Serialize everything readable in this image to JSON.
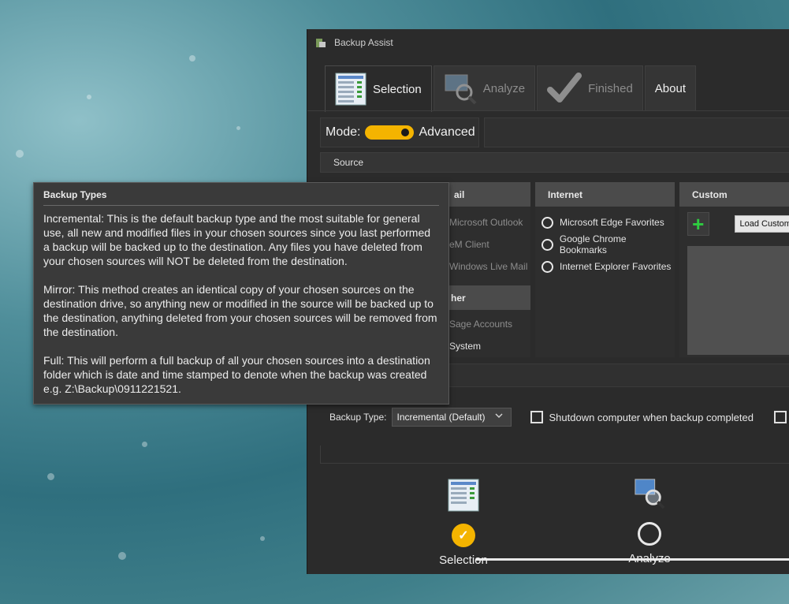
{
  "window": {
    "title": "Backup Assist"
  },
  "tabs": [
    {
      "label": "Selection",
      "active": true
    },
    {
      "label": "Analyze",
      "active": false
    },
    {
      "label": "Finished",
      "active": false
    },
    {
      "label": "About",
      "active": false
    }
  ],
  "mode": {
    "label": "Mode:",
    "value": "Advanced",
    "toggle_on": true
  },
  "source": {
    "label": "Source"
  },
  "email_panel": {
    "header": "ail",
    "items": [
      "Microsoft Outlook",
      "eM Client",
      "Windows Live Mail"
    ],
    "other_header": "her",
    "other_items": [
      "Sage Accounts",
      "System"
    ]
  },
  "internet_panel": {
    "header": "Internet",
    "items": [
      "Microsoft Edge Favorites",
      "Google Chrome Bookmarks",
      "Internet Explorer Favorites"
    ]
  },
  "custom_panel": {
    "header": "Custom",
    "add_symbol": "+",
    "load_label": "Load Custom"
  },
  "options": {
    "backup_type_label": "Backup Type:",
    "backup_type_value": "Incremental (Default)",
    "shutdown_label": "Shutdown computer when backup completed"
  },
  "progress": {
    "steps": [
      {
        "label": "Selection",
        "done": true
      },
      {
        "label": "Analyze",
        "done": false
      }
    ],
    "done_glyph": "✓"
  },
  "tooltip": {
    "title": "Backup Types",
    "paragraphs": [
      "Incremental: This is the default backup type and the most suitable for general use, all new and modified files in your chosen sources since you last performed a backup will be backed up to the destination. Any files you have deleted from your chosen sources will NOT be deleted from the destination.",
      "Mirror: This method creates an identical copy of your chosen sources on the destination drive, so anything new or modified in the source will be backed up to the destination, anything deleted from your chosen sources will be removed from the destination.",
      "Full: This will perform a full backup of all your chosen sources into a destination folder which is date and time stamped to denote when the backup was created e.g. Z:\\Backup\\0911221521."
    ]
  },
  "colors": {
    "accent": "#f4b400",
    "add_green": "#2ecc40",
    "window_bg": "#2b2b2b"
  }
}
